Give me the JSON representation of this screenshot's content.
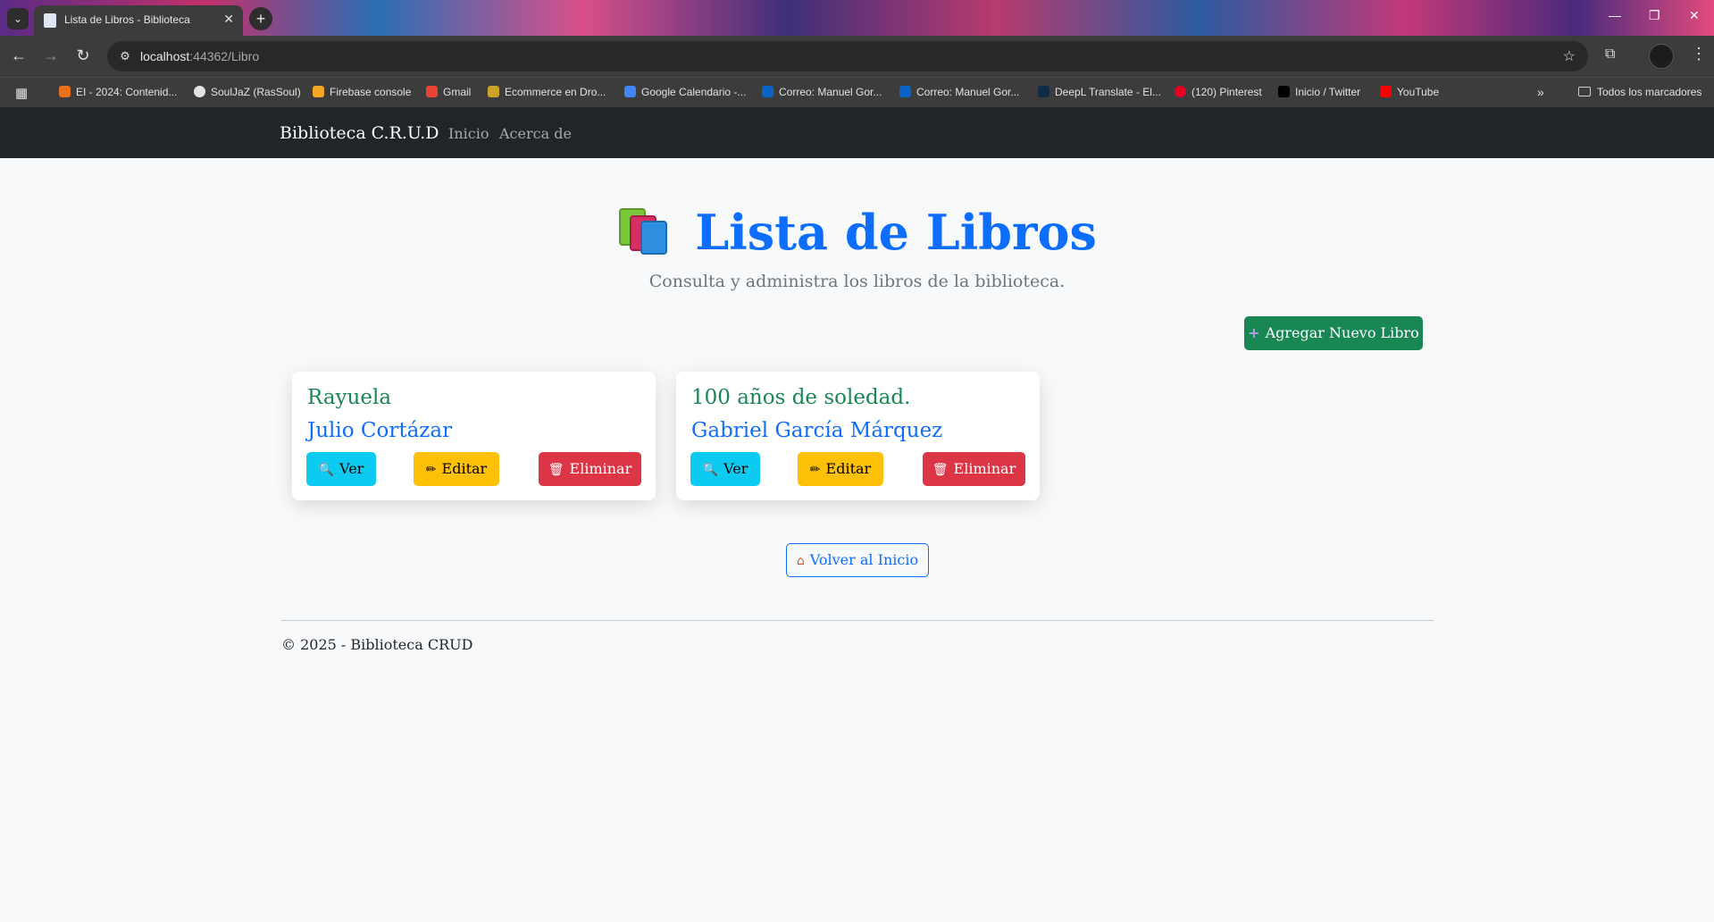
{
  "browser": {
    "tab_title": "Lista de Libros - Biblioteca",
    "url_host": "localhost",
    "url_path": ":44362/Libro",
    "bookmarks": [
      {
        "label": "EI - 2024: Contenid...",
        "color": "#e8711a"
      },
      {
        "label": "SoulJaZ (RasSoul)",
        "color": "#e3e3e3"
      },
      {
        "label": "Firebase console",
        "color": "#f5a623"
      },
      {
        "label": "Gmail",
        "color": "#ea4335"
      },
      {
        "label": "Ecommerce en Dro...",
        "color": "#c9a227"
      },
      {
        "label": "Google Calendario -...",
        "color": "#4285f4"
      },
      {
        "label": "Correo: Manuel Gor...",
        "color": "#0a64c7"
      },
      {
        "label": "Correo: Manuel Gor...",
        "color": "#0a64c7"
      },
      {
        "label": "DeepL Translate - El...",
        "color": "#0f2b46"
      },
      {
        "label": "(120) Pinterest",
        "color": "#e60023"
      },
      {
        "label": "Inicio / Twitter",
        "color": "#000000"
      },
      {
        "label": "YouTube",
        "color": "#ff0000"
      }
    ],
    "all_bookmarks": "Todos los marcadores"
  },
  "navbar": {
    "brand": "Biblioteca C.R.U.D",
    "links": [
      "Inicio",
      "Acerca de"
    ]
  },
  "page": {
    "title": "Lista de Libros",
    "subtitle": "Consulta y administra los libros de la biblioteca.",
    "add_button": "Agregar Nuevo Libro",
    "back_button": "Volver al Inicio"
  },
  "books": [
    {
      "title": "Rayuela",
      "author": "Julio Cortázar",
      "ver": "Ver",
      "editar": "Editar",
      "eliminar": "Eliminar"
    },
    {
      "title": "100 años de soledad.",
      "author": "Gabriel García Márquez",
      "ver": "Ver",
      "editar": "Editar",
      "eliminar": "Eliminar"
    }
  ],
  "footer": "© 2025 - Biblioteca CRUD",
  "colors": {
    "primary": "#0d6efd",
    "success": "#198754",
    "info": "#0dcaf0",
    "warning": "#ffc107",
    "danger": "#dc3545",
    "navbar": "#212529"
  }
}
